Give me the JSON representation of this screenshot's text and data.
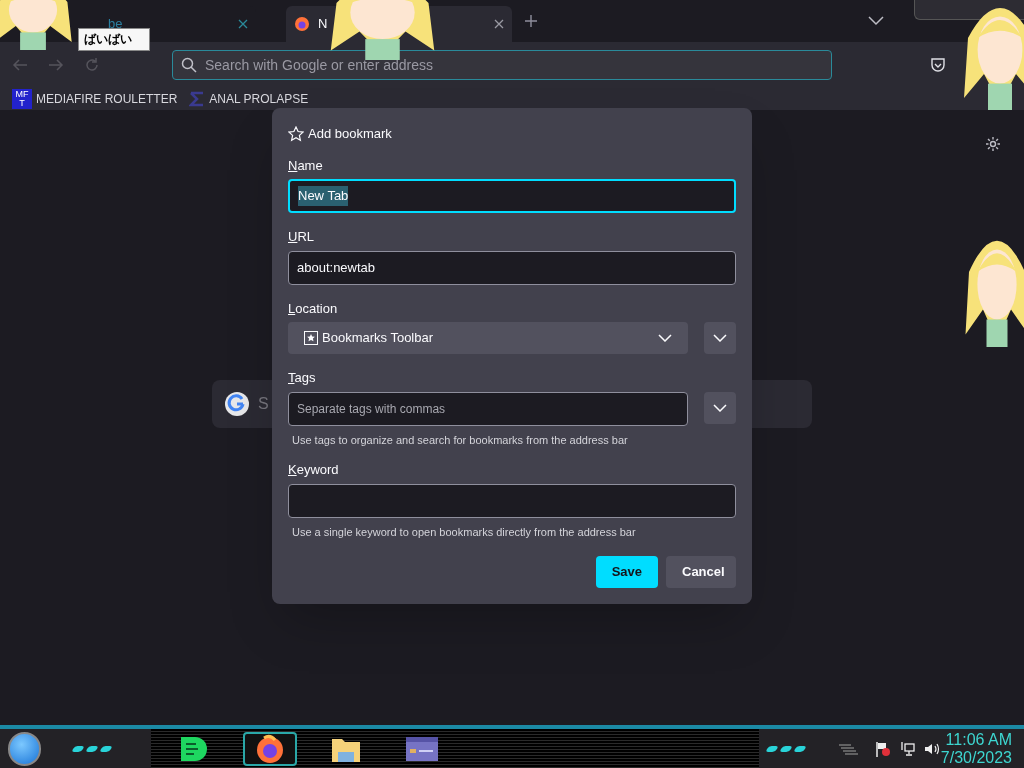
{
  "tabs": [
    {
      "title": "be",
      "selected": false
    },
    {
      "title": "N",
      "selected": true
    }
  ],
  "tooltip": "ばいばい",
  "address_bar": {
    "placeholder": "Search with Google or enter address"
  },
  "bookmarks": [
    {
      "label": "MEDIAFIRE ROULETTER",
      "kind": "mft",
      "icon_text": [
        "MF",
        "T"
      ]
    },
    {
      "label": "ANAL PROLAPSE",
      "kind": "sigma"
    }
  ],
  "page_search": {
    "placeholder": "S"
  },
  "dialog": {
    "title": "Add bookmark",
    "fields": [
      {
        "label": "Name",
        "kind": "text",
        "value": "New Tab",
        "focused": true
      },
      {
        "label": "URL",
        "kind": "text",
        "value": "about:newtab",
        "focused": false
      },
      {
        "label": "Location",
        "kind": "select",
        "value": "Bookmarks Toolbar",
        "focused": false
      },
      {
        "label": "Tags",
        "kind": "tags",
        "placeholder": "Separate tags with commas",
        "hint": "Use tags to organize and search for bookmarks from the address bar",
        "focused": false
      },
      {
        "label": "Keyword",
        "kind": "text",
        "hint": "Use a single keyword to open bookmarks directly from the address bar",
        "focused": false
      }
    ],
    "buttons": [
      {
        "label": "Save",
        "kind": "primary"
      },
      {
        "label": "Cancel",
        "kind": "secondary"
      }
    ]
  },
  "taskbar": {
    "apps": [
      {
        "kind": "music",
        "selected": false
      },
      {
        "kind": "browser",
        "selected": true
      },
      {
        "kind": "folder",
        "selected": false
      },
      {
        "kind": "window",
        "selected": false
      }
    ],
    "time": "11:06 AM",
    "date": "7/30/2023"
  }
}
